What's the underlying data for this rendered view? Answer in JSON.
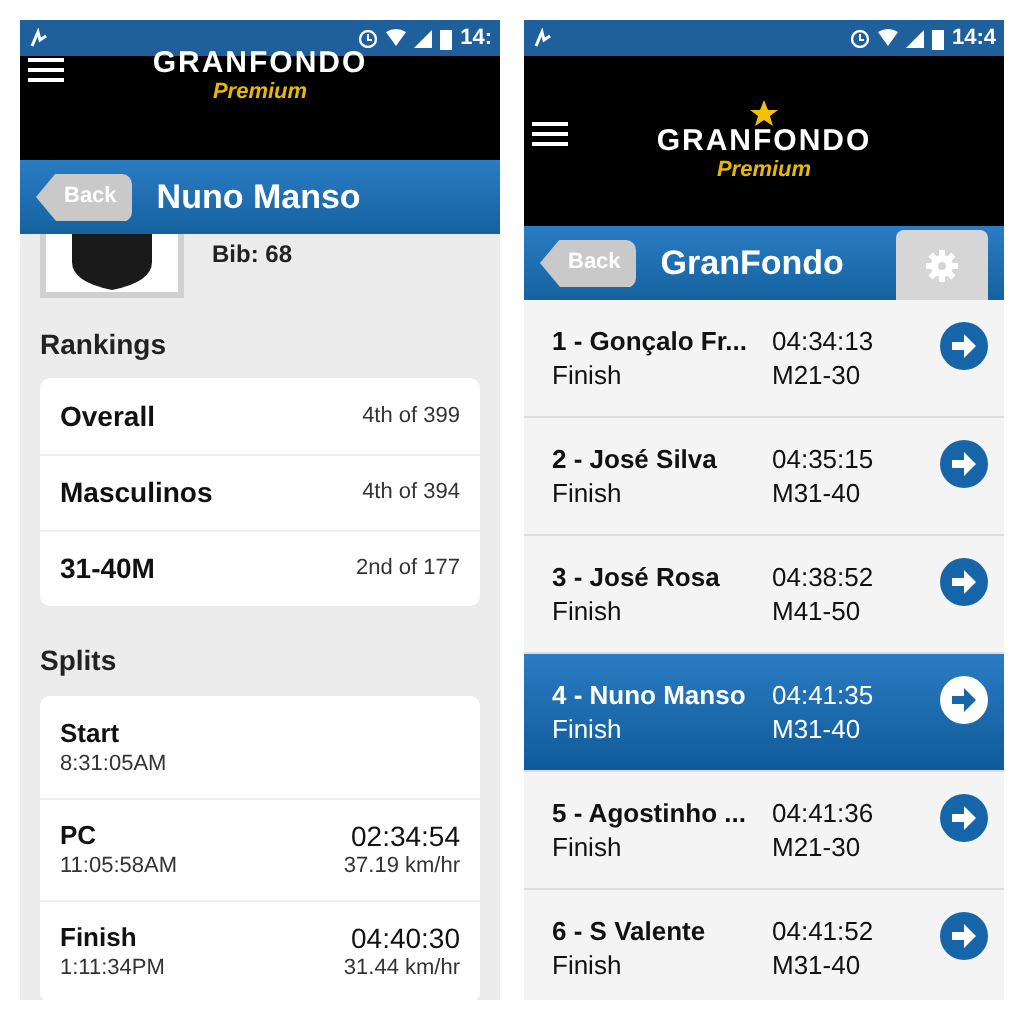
{
  "left_screen": {
    "status_bar": {
      "time": "14:"
    },
    "logo": {
      "name": "GRANFONDO",
      "tagline": "Premium"
    },
    "title_bar": {
      "back": "Back",
      "title": "Nuno Manso"
    },
    "bib": "Bib: 68",
    "rankings": {
      "heading": "Rankings",
      "rows": [
        {
          "label": "Overall",
          "value": "4th of 399"
        },
        {
          "label": "Masculinos",
          "value": "4th of 394"
        },
        {
          "label": "31-40M",
          "value": "2nd of 177"
        }
      ]
    },
    "splits": {
      "heading": "Splits",
      "rows": [
        {
          "label": "Start",
          "clock": "8:31:05AM"
        },
        {
          "label": "PC",
          "clock": "11:05:58AM",
          "time": "02:34:54",
          "speed": "37.19 km/hr"
        },
        {
          "label": "Finish",
          "clock": "1:11:34PM",
          "time": "04:40:30",
          "speed": "31.44 km/hr"
        }
      ]
    }
  },
  "right_screen": {
    "status_bar": {
      "time": "14:4"
    },
    "logo": {
      "name": "GRANFONDO",
      "tagline": "Premium"
    },
    "title_bar": {
      "back": "Back",
      "title": "GranFondo"
    },
    "results": [
      {
        "name": "1 - Gonçalo Fr...",
        "status": "Finish",
        "time": "04:34:13",
        "category": "M21-30",
        "selected": false
      },
      {
        "name": "2 - José Silva",
        "status": "Finish",
        "time": "04:35:15",
        "category": "M31-40",
        "selected": false
      },
      {
        "name": "3 - José Rosa",
        "status": "Finish",
        "time": "04:38:52",
        "category": "M41-50",
        "selected": false
      },
      {
        "name": "4 - Nuno Manso",
        "status": "Finish",
        "time": "04:41:35",
        "category": "M31-40",
        "selected": true
      },
      {
        "name": "5 - Agostinho ...",
        "status": "Finish",
        "time": "04:41:36",
        "category": "M21-30",
        "selected": false
      },
      {
        "name": "6 - S Valente",
        "status": "Finish",
        "time": "04:41:52",
        "category": "M31-40",
        "selected": false
      }
    ]
  }
}
